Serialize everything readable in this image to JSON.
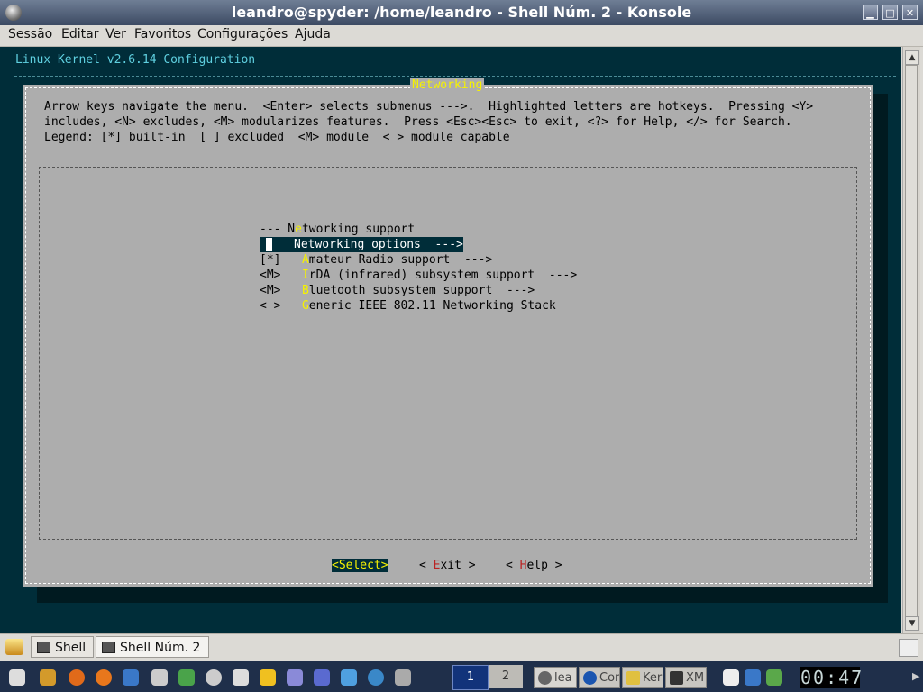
{
  "window": {
    "title": "leandro@spyder: /home/leandro - Shell Núm. 2 - Konsole",
    "buttons": {
      "minimize": "▁",
      "maximize": "□",
      "close": "✕"
    }
  },
  "menubar": [
    "Sessão",
    "Editar",
    "Ver",
    "Favoritos",
    "Configurações",
    "Ajuda"
  ],
  "terminal": {
    "config_title": "Linux Kernel v2.6.14 Configuration",
    "dialog": {
      "title": "Networking",
      "help_lines": [
        "Arrow keys navigate the menu.  <Enter> selects submenus --->.  Highlighted letters are hotkeys.  Pressing <Y>",
        "includes, <N> excludes, <M> modularizes features.  Press <Esc><Esc> to exit, <?> for Help, </> for Search.",
        "Legend: [*] built-in  [ ] excluded  <M> module  < > module capable"
      ],
      "items": [
        {
          "prefix": "--- N",
          "hotkey": "e",
          "rest": "tworking support"
        },
        {
          "prefix": "",
          "hotkey": "N",
          "rest": "etworking options  --->",
          "selected": true
        },
        {
          "prefix": "[*]   ",
          "hotkey": "A",
          "rest": "mateur Radio support  --->"
        },
        {
          "prefix": "<M>   ",
          "hotkey": "I",
          "rest": "rDA (infrared) subsystem support  --->"
        },
        {
          "prefix": "<M>   ",
          "hotkey": "B",
          "rest": "luetooth subsystem support  --->"
        },
        {
          "prefix": "< >   ",
          "hotkey": "G",
          "rest": "eneric IEEE 802.11 Networking Stack"
        }
      ],
      "buttons": {
        "select": "<Select>",
        "exit": {
          "pre": "< ",
          "hotkey": "E",
          "rest": "xit >"
        },
        "help": {
          "pre": "< ",
          "hotkey": "H",
          "rest": "elp >"
        }
      }
    }
  },
  "tabs": [
    {
      "label": "Shell"
    },
    {
      "label": "Shell Núm. 2",
      "active": true
    }
  ],
  "taskbar": {
    "desktops": [
      "1",
      "2"
    ],
    "tasks": [
      "lea",
      "Cor",
      "Ker",
      "XM"
    ],
    "clock": "00:47"
  },
  "colors": {
    "terminal_bg": "#002d39",
    "dialog_bg": "#adadad",
    "hotkey": "#f6f200",
    "button_hotkey": "#b22222"
  }
}
